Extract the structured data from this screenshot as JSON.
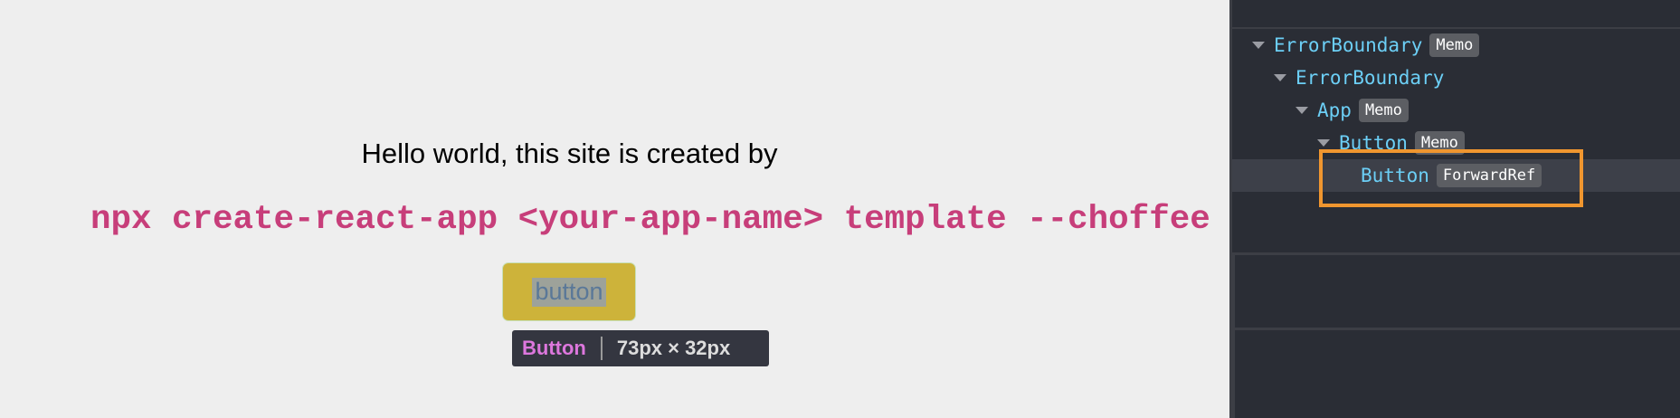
{
  "page": {
    "hello_text": "Hello world, this site is created by",
    "command_text": "npx create-react-app <your-app-name> template --choffee",
    "button_label": "button"
  },
  "inspect_tooltip": {
    "component": "Button",
    "size": "73px × 32px"
  },
  "devtools": {
    "tree": [
      {
        "name": "ErrorBoundary",
        "badge": "Memo",
        "depth": 0,
        "expanded": true
      },
      {
        "name": "ErrorBoundary",
        "badge": "",
        "depth": 1,
        "expanded": true
      },
      {
        "name": "App",
        "badge": "Memo",
        "depth": 2,
        "expanded": true
      },
      {
        "name": "Button",
        "badge": "Memo",
        "depth": 3,
        "expanded": true
      },
      {
        "name": "Button",
        "badge": "ForwardRef",
        "depth": 4,
        "expanded": false,
        "selected": true
      }
    ]
  },
  "colors": {
    "command": "#c73e7a",
    "component_name": "#6ccff6",
    "highlight_box": "#f0962f",
    "button_bg": "#cdb33a",
    "tooltip_name": "#dd77dd"
  }
}
